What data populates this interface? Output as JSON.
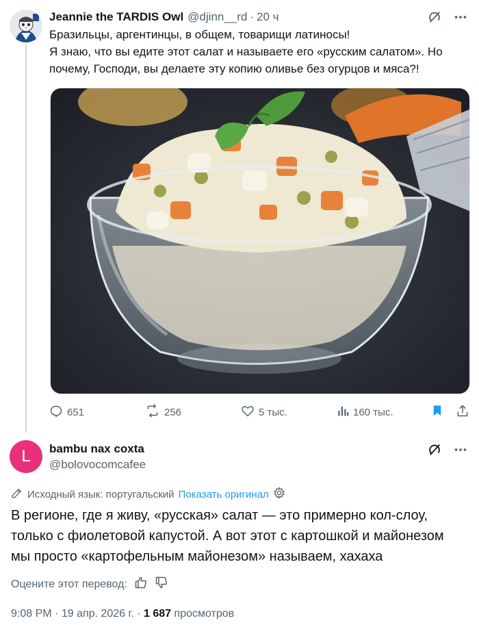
{
  "tweet1": {
    "author_name": "Jeannie the TARDIS Owl",
    "handle": "@djinn__rd",
    "separator": "·",
    "time": "20 ч",
    "text_lines": [
      "Бразильцы, аргентинцы, в общем, товарищи латиносы!",
      "Я знаю, что вы едите этот салат и называете его «русским салатом». Но",
      "почему, Господи, вы делаете эту копию оливье без огурцов и мяса?!"
    ],
    "stats": {
      "replies": "651",
      "reposts": "256",
      "likes": "5 тыс.",
      "views": "160 тыс."
    }
  },
  "tweet2": {
    "avatar_letter": "L",
    "author_name": "bambu nax coxta",
    "handle": "@bolovocomcafee",
    "translation_source": "Исходный язык: португальский",
    "show_original": "Показать оригинал",
    "text_lines": [
      "В регионе, где я живу, «русская» салат — это примерно кол-слоу,",
      "только с фиолетовой капустой. А вот этот с картошкой и майонезом",
      "мы просто «картофельным майонезом» называем, хахаха"
    ],
    "rate_label": "Оцените этот перевод:",
    "meta": {
      "time": "9:08 PM",
      "date": "19 апр. 2026 г.",
      "views_count": "1 687",
      "views_label": "просмотров"
    }
  },
  "colors": {
    "accent": "#1d9bf0",
    "secondary_text": "#536471",
    "avatar2_bg": "#e9307a",
    "bookmark": "#1d9bf0"
  },
  "icons": [
    "grok-icon",
    "more-icon",
    "reply-icon",
    "repost-icon",
    "like-icon",
    "views-icon",
    "bookmark-icon",
    "share-icon",
    "translate-icon",
    "gear-icon",
    "thumbs-up-icon",
    "thumbs-down-icon"
  ]
}
